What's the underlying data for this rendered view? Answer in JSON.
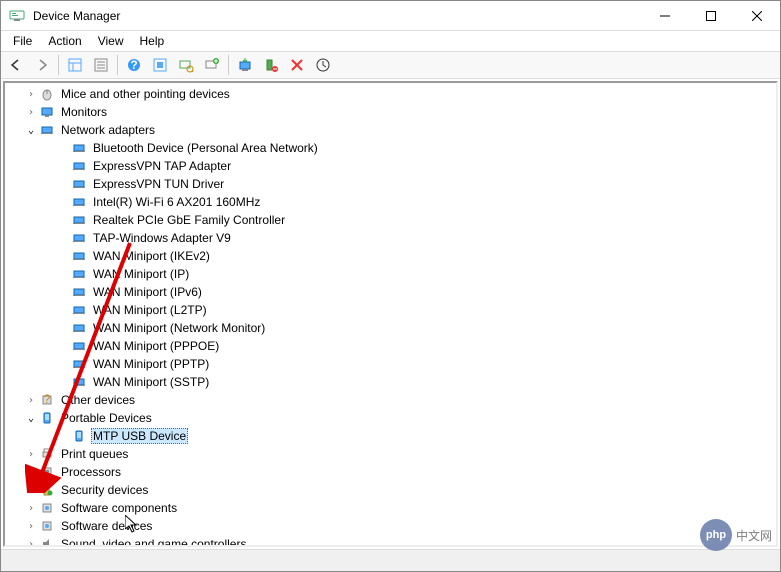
{
  "window": {
    "title": "Device Manager"
  },
  "menus": [
    "File",
    "Action",
    "View",
    "Help"
  ],
  "tree": {
    "mice": "Mice and other pointing devices",
    "monitors": "Monitors",
    "network": "Network adapters",
    "net_items": [
      "Bluetooth Device (Personal Area Network)",
      "ExpressVPN TAP Adapter",
      "ExpressVPN TUN Driver",
      "Intel(R) Wi-Fi 6 AX201 160MHz",
      "Realtek PCIe GbE Family Controller",
      "TAP-Windows Adapter V9",
      "WAN Miniport (IKEv2)",
      "WAN Miniport (IP)",
      "WAN Miniport (IPv6)",
      "WAN Miniport (L2TP)",
      "WAN Miniport (Network Monitor)",
      "WAN Miniport (PPPOE)",
      "WAN Miniport (PPTP)",
      "WAN Miniport (SSTP)"
    ],
    "other": "Other devices",
    "portable": "Portable Devices",
    "mtp": "MTP USB Device",
    "printq": "Print queues",
    "processors": "Processors",
    "security": "Security devices",
    "swcomp": "Software components",
    "swdev": "Software devices",
    "sound": "Sound, video and game controllers"
  },
  "watermark": "中文网"
}
